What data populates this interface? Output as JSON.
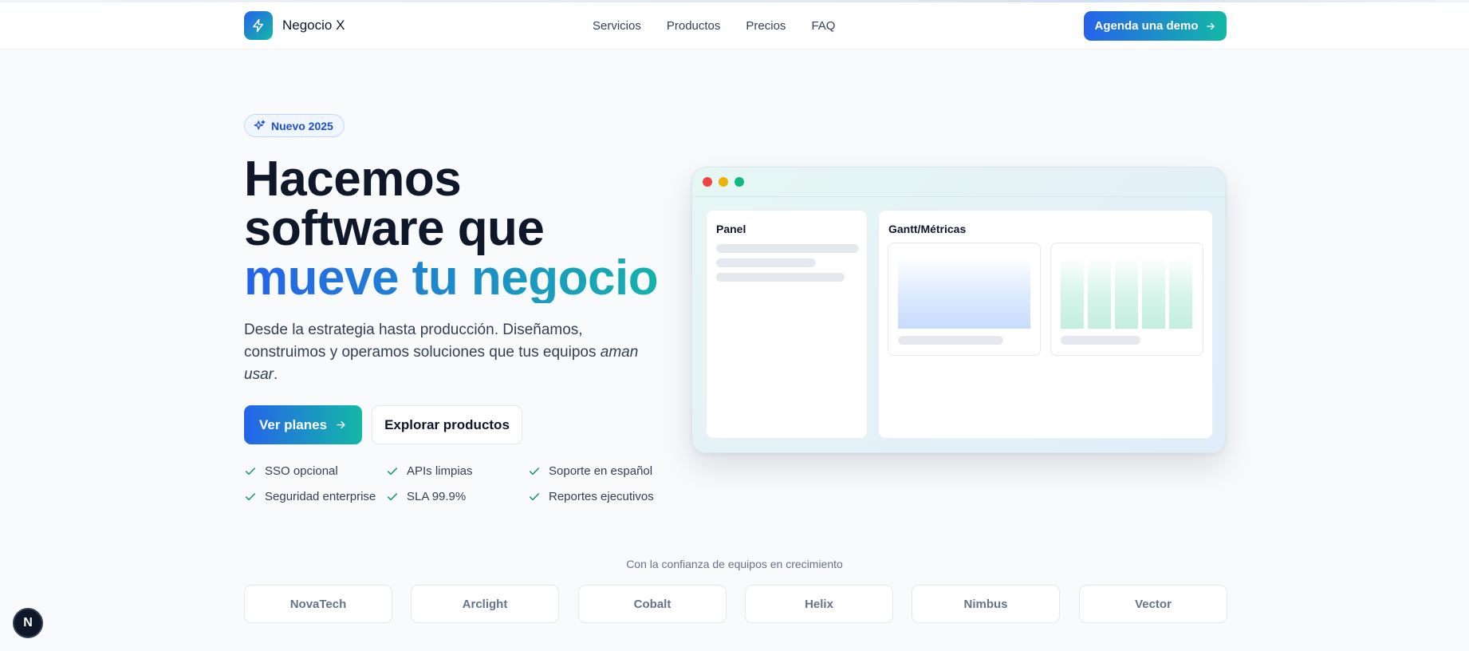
{
  "brand": {
    "name": "Negocio X",
    "logo_icon": "lightning-icon"
  },
  "nav": {
    "links": [
      "Servicios",
      "Productos",
      "Precios",
      "FAQ"
    ],
    "cta_label": "Agenda una demo"
  },
  "hero": {
    "badge": "Nuevo 2025",
    "title_line1": "Hacemos",
    "title_line2": "software que",
    "title_highlight": "mueve tu negocio",
    "description_prefix": "Desde la estrategia hasta producción. Diseñamos, construimos y operamos soluciones que tus equipos ",
    "description_emphasis": "aman usar",
    "description_suffix": ".",
    "primary_cta": "Ver planes",
    "secondary_cta": "Explorar productos",
    "features": [
      "SSO opcional",
      "APIs limpias",
      "Soporte en español",
      "Seguridad enterprise",
      "SLA 99.9%",
      "Reportes ejecutivos"
    ]
  },
  "mockup": {
    "panel_title": "Panel",
    "gantt_title": "Gantt/Métricas",
    "window_dot_colors": [
      "#ef4444",
      "#eab308",
      "#10b981"
    ]
  },
  "trust": {
    "label": "Con la confianza de equipos en crecimiento",
    "logos": [
      "NovaTech",
      "Arclight",
      "Cobalt",
      "Helix",
      "Nimbus",
      "Vector"
    ]
  },
  "dev_badge": {
    "label": "N"
  },
  "colors": {
    "accent_blue": "#2563eb",
    "accent_teal": "#14b8a6",
    "check_green": "#059669"
  }
}
